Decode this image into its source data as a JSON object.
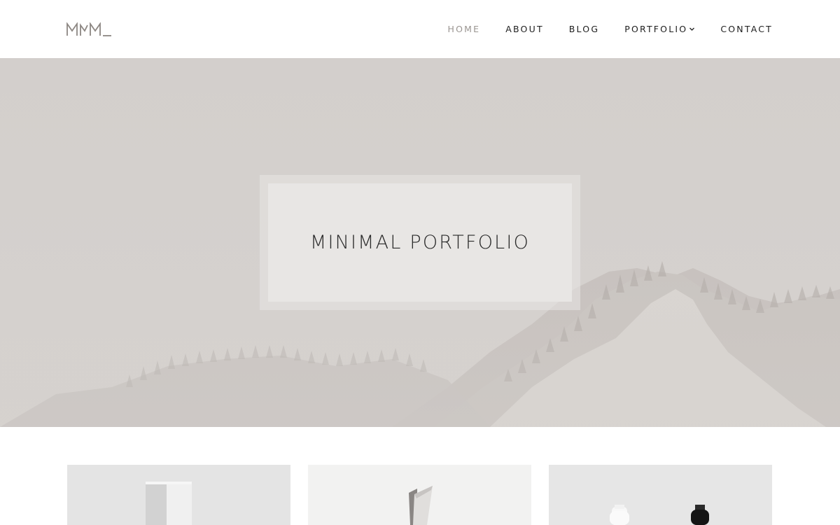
{
  "brand": {
    "logo_text": "MNM_"
  },
  "nav": {
    "items": [
      {
        "label": "HOME",
        "active": true
      },
      {
        "label": "ABOUT",
        "active": false
      },
      {
        "label": "BLOG",
        "active": false
      },
      {
        "label": "PORTFOLIO",
        "active": false,
        "has_dropdown": true
      },
      {
        "label": "CONTACT",
        "active": false
      }
    ]
  },
  "hero": {
    "title": "MINIMAL PORTFOLIO",
    "image": "misty-mountain-forest"
  },
  "gallery": {
    "items": [
      {
        "image": "white-box-product"
      },
      {
        "image": "angled-shape-product"
      },
      {
        "image": "bottles-product"
      }
    ]
  },
  "colors": {
    "accent_nav_active": "#9a9591",
    "hero_bg": "#d4d0cd",
    "text": "#1e1e1e"
  }
}
